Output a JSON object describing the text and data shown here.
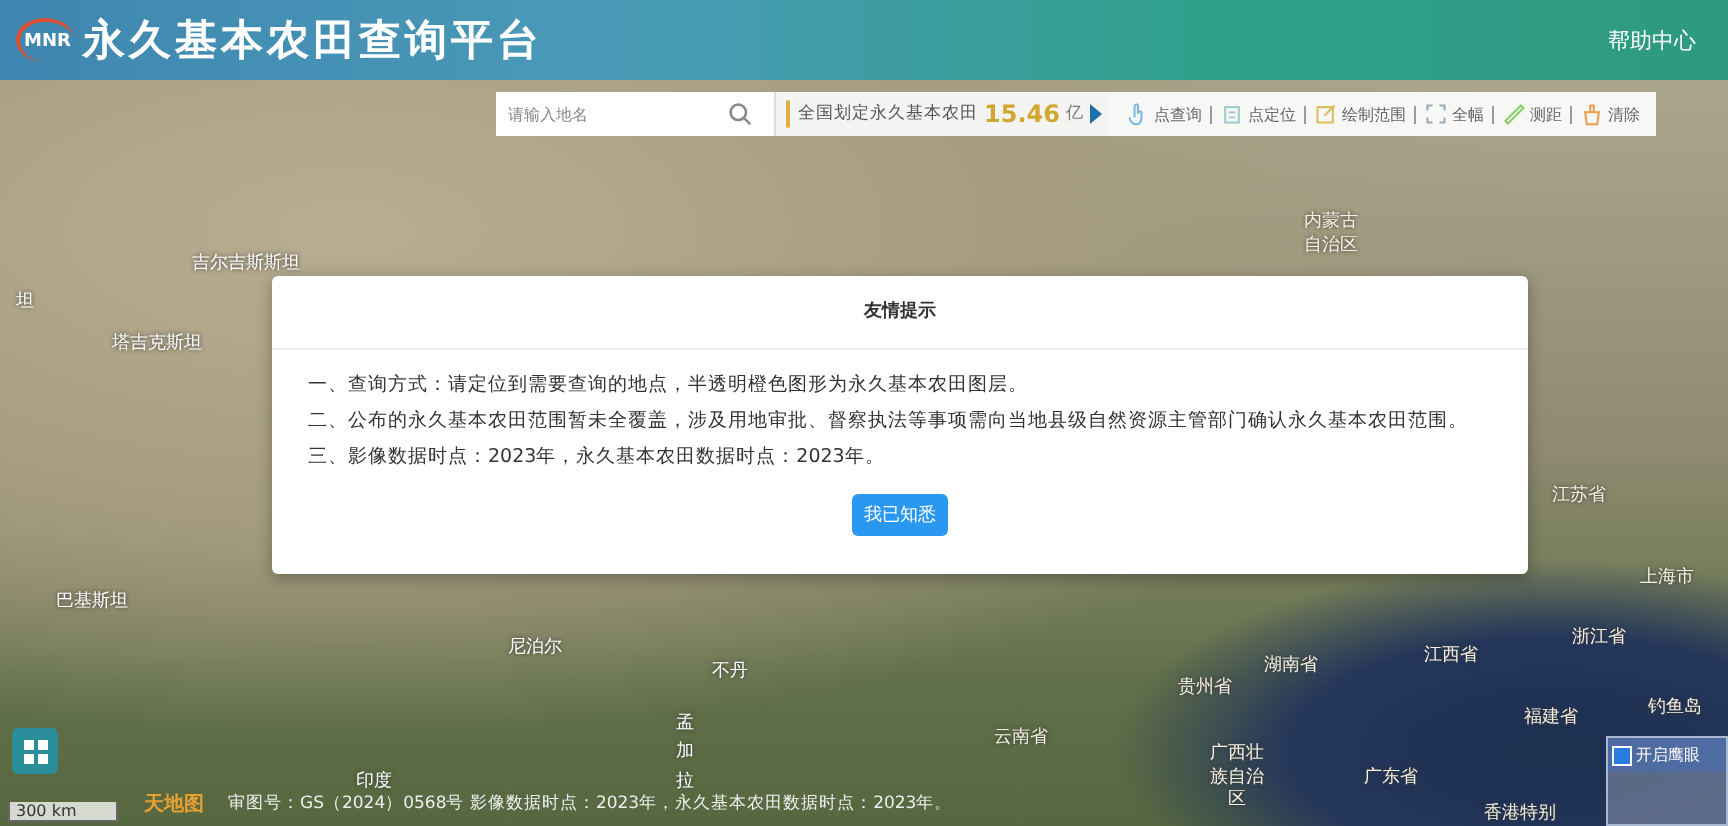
{
  "header": {
    "logo_text": "MNR",
    "title": "永久基本农田查询平台",
    "help_link": "帮助中心"
  },
  "search": {
    "placeholder": "请输入地名"
  },
  "stat": {
    "label": "全国划定永久基本农田",
    "value": "15.46",
    "unit": "亿"
  },
  "toolbar": [
    {
      "kind": "query",
      "label": "点查询"
    },
    {
      "kind": "locate",
      "label": "点定位"
    },
    {
      "kind": "draw",
      "label": "绘制范围"
    },
    {
      "kind": "full",
      "label": "全幅"
    },
    {
      "kind": "measure",
      "label": "测距"
    },
    {
      "kind": "clear",
      "label": "清除"
    }
  ],
  "map_labels": [
    "坦",
    "吉尔吉斯斯坦",
    "塔吉克斯坦",
    "巴基斯坦",
    "尼泊尔",
    "不丹",
    "印度",
    "孟加拉",
    "内蒙古自治区",
    "江苏省",
    "上海市",
    "湖南省",
    "江西省",
    "浙江省",
    "贵州省",
    "云南省",
    "广西壮族自治区",
    "广东省",
    "福建省",
    "香港特别",
    "钓鱼岛"
  ],
  "dialog": {
    "title": "友情提示",
    "lines": [
      "一、查询方式：请定位到需要查询的地点，半透明橙色图形为永久基本农田图层。",
      "二、公布的永久基本农田范围暂未全覆盖，涉及用地审批、督察执法等事项需向当地县级自然资源主管部门确认永久基本农田范围。",
      "三、影像数据时点：2023年，永久基本农田数据时点：2023年。"
    ],
    "button": "我已知悉"
  },
  "scale": "300 km",
  "map_logo": "天地图",
  "attribution": "审图号：GS（2024）0568号 影像数据时点：2023年，永久基本农田数据时点：2023年。",
  "overview": {
    "label": "开启鹰眼",
    "checked": true
  }
}
